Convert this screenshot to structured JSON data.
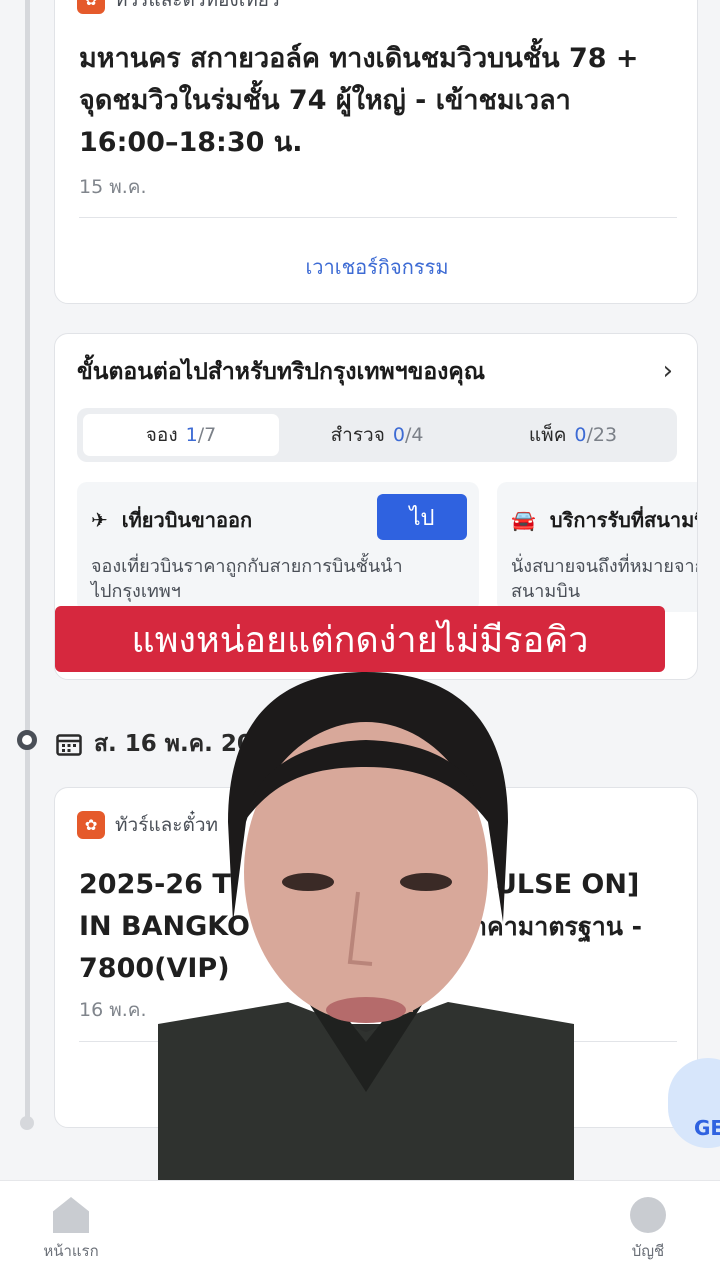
{
  "top_card": {
    "category": "ทัวร์และตั๋วท่องเที่ยว",
    "title_lines": [
      "มหานคร สกายวอล์ค ทางเดินชมวิวบนชั้น 78 +",
      "จุดชมวิวในร่มชั้น 74    ผู้ใหญ่ - เข้าชมเวลา",
      "16:00–18:30 น."
    ],
    "date": "15 พ.ค.",
    "link": "เวาเชอร์กิจกรรม"
  },
  "next_steps": {
    "title": "ขั้นตอนต่อไปสำหรับทริปกรุงเทพฯของคุณ",
    "tabs": [
      {
        "label": "จอง",
        "count": "1",
        "total": "/7",
        "active": true
      },
      {
        "label": "สำรวจ",
        "count": "0",
        "total": "/4",
        "active": false
      },
      {
        "label": "แพ็ค",
        "count": "0",
        "total": "/23",
        "active": false
      }
    ],
    "suggestions": [
      {
        "icon": "plane-icon",
        "title": "เที่ยวบินขาออก",
        "button": "ไป",
        "desc_lines": [
          "จองเที่ยวบินราคาถูกกับสายการบินชั้นนำ",
          "ไปกรุงเทพฯ"
        ]
      },
      {
        "icon": "car-icon",
        "title": "บริการรับที่สนามบิน",
        "desc_lines": [
          "นั่งสบายจนถึงที่หมายจาก",
          "สนามบิน"
        ]
      }
    ]
  },
  "caption": "แพงหน่อยแต่กดง่ายไม่มีรอคิว",
  "day": {
    "label": "ส. 16 พ.ค. 20"
  },
  "second_card": {
    "category": "ทัวร์และตั๋วท",
    "title_lines": [
      "2025-26 T",
      "IN BANGKO",
      "7800(VIP)"
    ],
    "title_right": [
      "ULSE ON]",
      "าคามาตรฐาน -"
    ],
    "date": "16 พ.ค."
  },
  "gen_badge": "GE",
  "bottom_nav": {
    "home": "หน้าแรก",
    "account": "บัญชี"
  },
  "colors": {
    "accent": "#2f62e0",
    "caption_bg": "#d6283e",
    "category_icon": "#e55a2b"
  }
}
